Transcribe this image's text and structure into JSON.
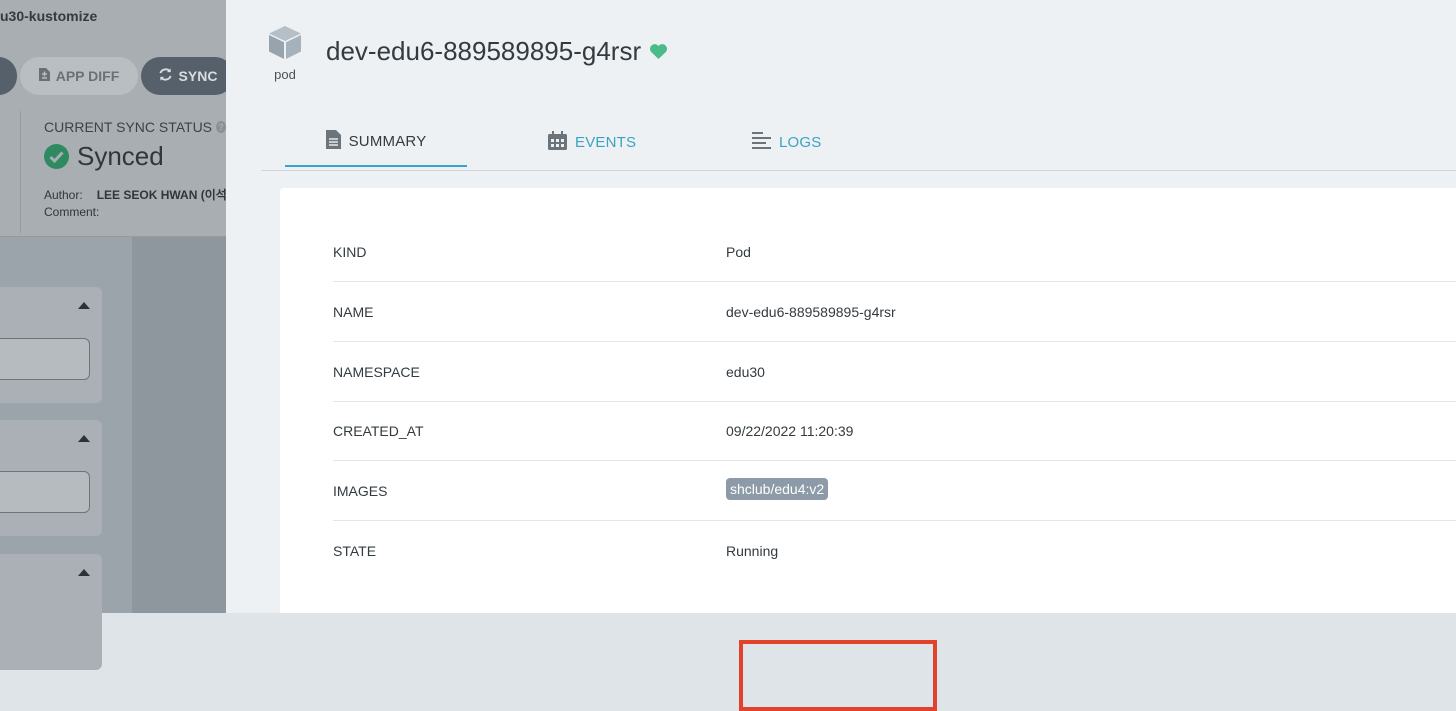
{
  "background": {
    "app_title": "u30-kustomize",
    "buttons": {
      "app_diff": "APP DIFF",
      "sync": "SYNC"
    },
    "sync_status": {
      "label": "CURRENT SYNC STATUS",
      "help": "?",
      "value": "Synced",
      "author_label": "Author:",
      "author_value": "LEE SEOK HWAN (이석",
      "comment_label": "Comment:"
    }
  },
  "panel": {
    "kind_caption": "pod",
    "resource_name": "dev-edu6-889589895-g4rsr",
    "health": "healthy",
    "tabs": [
      {
        "label": "SUMMARY",
        "icon": "document-icon",
        "active": true
      },
      {
        "label": "EVENTS",
        "icon": "calendar-icon",
        "active": false
      },
      {
        "label": "LOGS",
        "icon": "align-left-icon",
        "active": false
      }
    ],
    "summary": {
      "rows": [
        {
          "key": "KIND",
          "value": "Pod"
        },
        {
          "key": "NAME",
          "value": "dev-edu6-889589895-g4rsr"
        },
        {
          "key": "NAMESPACE",
          "value": "edu30"
        },
        {
          "key": "CREATED_AT",
          "value": "09/22/2022 11:20:39"
        },
        {
          "key": "IMAGES",
          "value": "shclub/edu4:v2"
        },
        {
          "key": "STATE",
          "value": "Running"
        }
      ]
    }
  },
  "colors": {
    "accent": "#36a6ca",
    "healthy": "#4cbb8a",
    "highlight": "#e2412b",
    "image_chip": "#8c9ba7"
  }
}
